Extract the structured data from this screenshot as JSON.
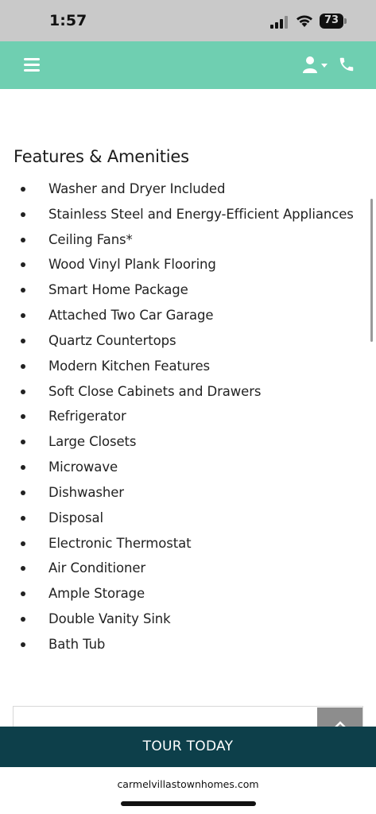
{
  "status_bar": {
    "time": "1:57",
    "battery": "73",
    "icons": [
      "signal-icon",
      "wifi-icon",
      "battery-icon"
    ]
  },
  "header": {
    "background_color": "#6fcfb1",
    "icons": [
      "hamburger-menu-icon",
      "user-icon",
      "caret-down-icon",
      "phone-icon"
    ]
  },
  "features": {
    "title": "Features & Amenities",
    "items": [
      "Washer and Dryer Included",
      "Stainless Steel and Energy-Efficient Appliances",
      "Ceiling Fans*",
      "Wood Vinyl Plank Flooring",
      "Smart Home Package",
      "Attached Two Car Garage",
      "Quartz Countertops",
      "Modern Kitchen Features",
      "Soft Close Cabinets and Drawers",
      "Refrigerator",
      "Large Closets",
      "Microwave",
      "Dishwasher",
      "Disposal",
      "Electronic Thermostat",
      "Air Conditioner",
      "Ample Storage",
      "Double Vanity Sink",
      "Bath Tub"
    ]
  },
  "cta": {
    "label": "TOUR TODAY",
    "background_color": "#0d3f4a"
  },
  "browser": {
    "url": "carmelvillastownhomes.com"
  }
}
